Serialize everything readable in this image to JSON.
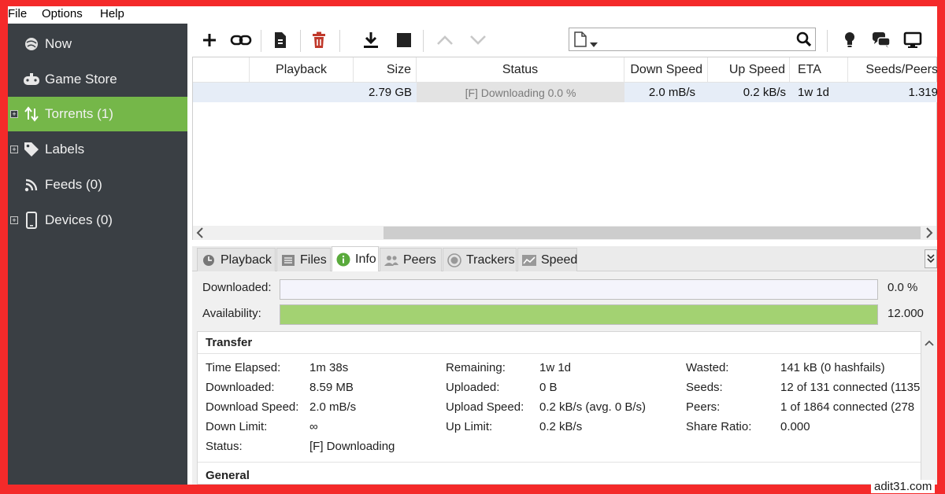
{
  "menu": [
    "File",
    "Options",
    "Help"
  ],
  "sidebar": {
    "items": [
      {
        "label": "Now",
        "icon": "globe-icon"
      },
      {
        "label": "Game Store",
        "icon": "gamepad-icon"
      },
      {
        "label": "Torrents (1)",
        "icon": "up-down-arrows-icon",
        "active": true
      },
      {
        "label": "Labels",
        "icon": "tag-icon"
      },
      {
        "label": "Feeds (0)",
        "icon": "rss-icon"
      },
      {
        "label": "Devices (0)",
        "icon": "phone-icon"
      }
    ]
  },
  "toolbar": {
    "icons": [
      "add-icon",
      "link-icon",
      "create-torrent-icon",
      "delete-icon",
      "download-icon",
      "stop-icon",
      "move-up-icon",
      "move-down-icon",
      "search-icon",
      "bulb-icon",
      "chat-icon",
      "monitor-icon"
    ],
    "search_placeholder": ""
  },
  "list": {
    "columns": [
      "Playback",
      "Size",
      "Status",
      "Down Speed",
      "Up Speed",
      "ETA",
      "Seeds/Peers"
    ],
    "rows": [
      {
        "size": "2.79 GB",
        "status": "[F] Downloading 0.0 %",
        "down_speed": "2.0 mB/s",
        "up_speed": "0.2 kB/s",
        "eta": "1w 1d",
        "seeds_peers": "1.319"
      }
    ]
  },
  "tabs": [
    {
      "label": "Playback",
      "icon": "clock-icon"
    },
    {
      "label": "Files",
      "icon": "files-icon"
    },
    {
      "label": "Info",
      "icon": "info-icon",
      "active": true
    },
    {
      "label": "Peers",
      "icon": "peers-icon"
    },
    {
      "label": "Trackers",
      "icon": "trackers-icon"
    },
    {
      "label": "Speed",
      "icon": "speed-chart-icon"
    }
  ],
  "info": {
    "downloaded_label": "Downloaded:",
    "downloaded_value": "0.0 %",
    "downloaded_fraction": 0.0,
    "availability_label": "Availability:",
    "availability_value": "12.000",
    "availability_fraction": 1.0,
    "transfer_title": "Transfer",
    "general_title": "General",
    "col1": [
      {
        "k": "Time Elapsed:",
        "v": "1m 38s"
      },
      {
        "k": "Downloaded:",
        "v": "8.59 MB"
      },
      {
        "k": "Download Speed:",
        "v": "2.0 mB/s"
      },
      {
        "k": "Down Limit:",
        "v": "∞"
      },
      {
        "k": "Status:",
        "v": "[F] Downloading"
      }
    ],
    "col2": [
      {
        "k": "Remaining:",
        "v": "1w 1d"
      },
      {
        "k": "Uploaded:",
        "v": "0 B"
      },
      {
        "k": "Upload Speed:",
        "v": "0.2 kB/s (avg. 0 B/s)"
      },
      {
        "k": "Up Limit:",
        "v": "0.2 kB/s"
      }
    ],
    "col3": [
      {
        "k": "Wasted:",
        "v": "141 kB (0 hashfails)"
      },
      {
        "k": "Seeds:",
        "v": "12 of 131 connected (1135"
      },
      {
        "k": "Peers:",
        "v": "1 of 1864 connected (278"
      },
      {
        "k": "Share Ratio:",
        "v": "0.000"
      }
    ]
  },
  "watermark": "adit31.com",
  "colors": {
    "sidebar": "#3a3f44",
    "active": "#75b749",
    "frame": "#f42a2a"
  }
}
